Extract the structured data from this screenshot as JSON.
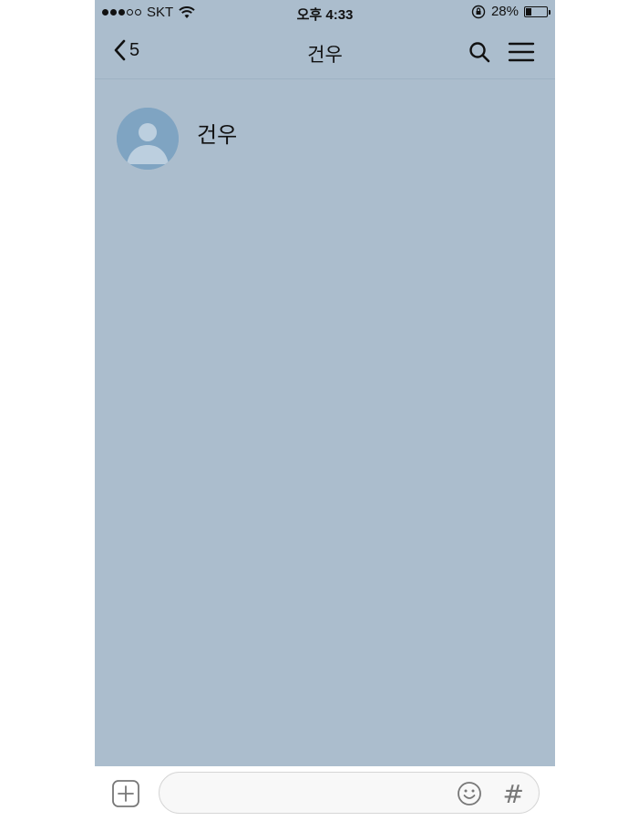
{
  "status_bar": {
    "carrier": "SKT",
    "time": "오후 4:33",
    "battery": "28%",
    "battery_level": 0.28,
    "signal_bars": 3,
    "signal_total": 5
  },
  "nav": {
    "back_count": "5",
    "title": "건우"
  },
  "profile": {
    "name": "건우"
  },
  "composer": {
    "placeholder": "",
    "hashtag": "#"
  },
  "colors": {
    "chat_background": "#abbdcd",
    "avatar_background": "#7fa4c2"
  },
  "icons": {
    "back": "chevron-left-icon",
    "search": "search-icon",
    "menu": "hamburger-menu-icon",
    "attach": "plus-square-icon",
    "emoji": "smiley-icon",
    "hashtag": "hashtag-icon"
  }
}
